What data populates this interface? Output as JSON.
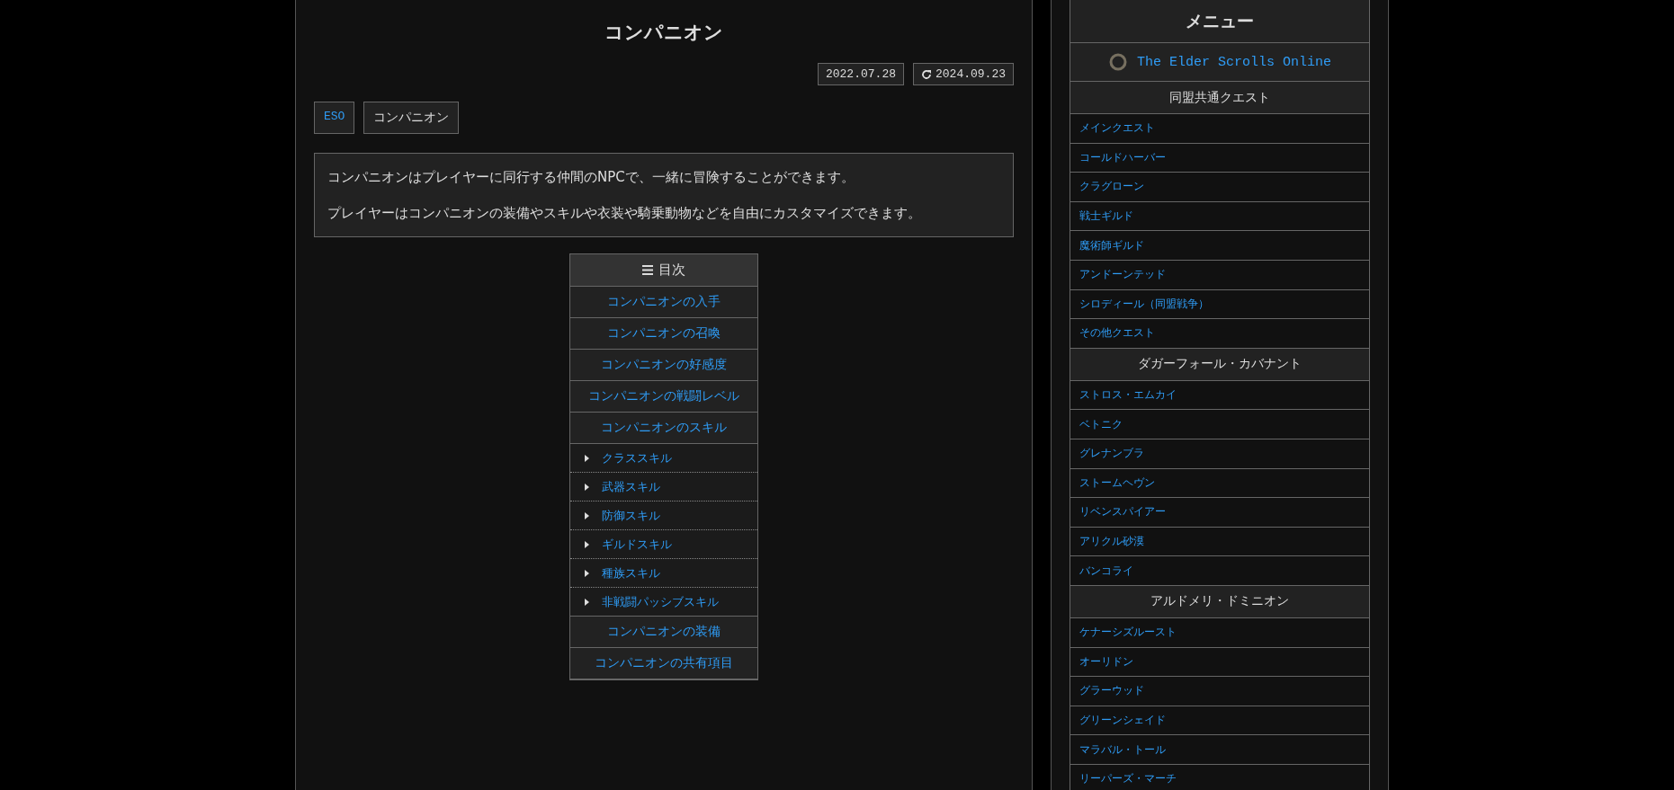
{
  "article": {
    "title": "コンパニオン",
    "created": "2022.07.28",
    "updated": "2024.09.23",
    "tags": [
      {
        "label": "ESO",
        "kind": "category"
      },
      {
        "label": "コンパニオン",
        "kind": "tag"
      }
    ],
    "intro": [
      "コンパニオンはプレイヤーに同行する仲間のNPCで、一緒に冒険することができます。",
      "プレイヤーはコンパニオンの装備やスキルや衣装や騎乗動物などを自由にカスタマイズできます。"
    ],
    "toc": {
      "title": "目次",
      "items": [
        {
          "label": "コンパニオンの入手"
        },
        {
          "label": "コンパニオンの召喚"
        },
        {
          "label": "コンパニオンの好感度"
        },
        {
          "label": "コンパニオンの戦闘レベル"
        },
        {
          "label": "コンパニオンのスキル",
          "children": [
            {
              "label": "クラススキル"
            },
            {
              "label": "武器スキル"
            },
            {
              "label": "防御スキル"
            },
            {
              "label": "ギルドスキル"
            },
            {
              "label": "種族スキル"
            },
            {
              "label": "非戦闘パッシブスキル"
            }
          ]
        },
        {
          "label": "コンパニオンの装備"
        },
        {
          "label": "コンパニオンの共有項目"
        }
      ]
    }
  },
  "sidebar": {
    "title": "メニュー",
    "site_link": "The Elder Scrolls Online",
    "sections": [
      {
        "title": "同盟共通クエスト",
        "items": [
          "メインクエスト",
          "コールドハーバー",
          "クラグローン",
          "戦士ギルド",
          "魔術師ギルド",
          "アンドーンテッド",
          "シロディール（同盟戦争）",
          "その他クエスト"
        ]
      },
      {
        "title": "ダガーフォール・カバナント",
        "items": [
          "ストロス・エムカイ",
          "ベトニク",
          "グレナンブラ",
          "ストームヘヴン",
          "リベンスパイアー",
          "アリクル砂漠",
          "バンコライ"
        ]
      },
      {
        "title": "アルドメリ・ドミニオン",
        "items": [
          "ケナーシズルースト",
          "オーリドン",
          "グラーウッド",
          "グリーンシェイド",
          "マラバル・トール",
          "リーパーズ・マーチ"
        ]
      }
    ]
  }
}
